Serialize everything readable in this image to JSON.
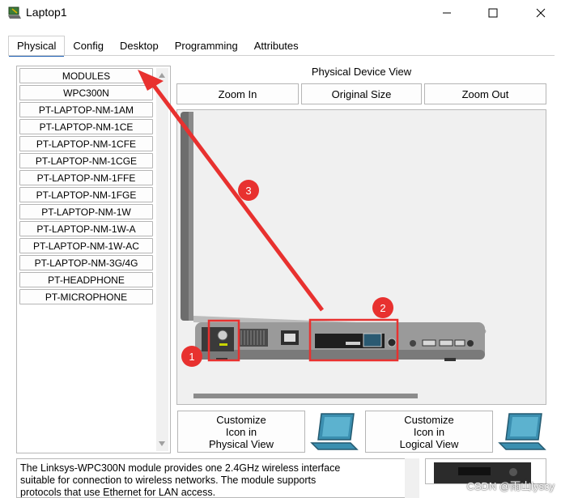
{
  "window": {
    "title": "Laptop1",
    "icon": "laptop-app-icon"
  },
  "tabs": [
    {
      "label": "Physical",
      "active": true
    },
    {
      "label": "Config",
      "active": false
    },
    {
      "label": "Desktop",
      "active": false
    },
    {
      "label": "Programming",
      "active": false
    },
    {
      "label": "Attributes",
      "active": false
    }
  ],
  "modules": {
    "items": [
      "MODULES",
      "WPC300N",
      "PT-LAPTOP-NM-1AM",
      "PT-LAPTOP-NM-1CE",
      "PT-LAPTOP-NM-1CFE",
      "PT-LAPTOP-NM-1CGE",
      "PT-LAPTOP-NM-1FFE",
      "PT-LAPTOP-NM-1FGE",
      "PT-LAPTOP-NM-1W",
      "PT-LAPTOP-NM-1W-A",
      "PT-LAPTOP-NM-1W-AC",
      "PT-LAPTOP-NM-3G/4G",
      "PT-HEADPHONE",
      "PT-MICROPHONE"
    ]
  },
  "device_view": {
    "title": "Physical Device View",
    "zoom_in": "Zoom In",
    "original_size": "Original Size",
    "zoom_out": "Zoom Out"
  },
  "customize": {
    "physical": {
      "line1": "Customize",
      "line2": "Icon in",
      "line3": "Physical View"
    },
    "logical": {
      "line1": "Customize",
      "line2": "Icon in",
      "line3": "Logical View"
    }
  },
  "description": {
    "line1": "The Linksys-WPC300N module provides one 2.4GHz wireless interface",
    "line2": "suitable for connection to wireless networks. The module supports",
    "line3": "protocols that use Ethernet for LAN access."
  },
  "annotations": {
    "badge1": "1",
    "badge2": "2",
    "badge3": "3",
    "color": "#e8312f"
  },
  "watermark": "CSDN @雨山lyscy",
  "colors": {
    "tab_underline": "#1e5fb3",
    "laptop_screen": "#3b8fb0",
    "annotation_red": "#e8312f"
  }
}
